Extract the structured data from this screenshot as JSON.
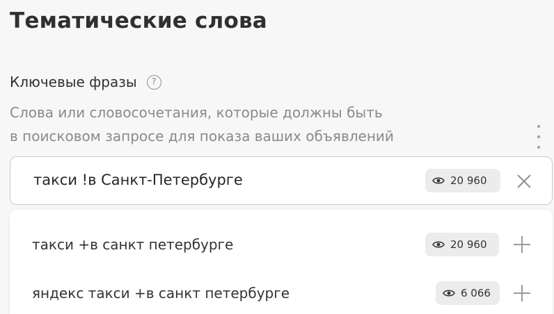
{
  "title": "Тематические слова",
  "keyphrases": {
    "label": "Ключевые фразы",
    "help_glyph": "?",
    "description_line1": "Слова или словосочетания, которые должны быть",
    "description_line2": "в поисковом запросе для показа ваших объявлений"
  },
  "input": {
    "value": "такси !в Санкт-Петербурге",
    "impressions": "20 960"
  },
  "suggestions": [
    {
      "phrase": "такси +в санкт петербурге",
      "impressions": "20 960"
    },
    {
      "phrase": "яндекс такси +в санкт петербурге",
      "impressions": "6 066"
    }
  ],
  "icons": {
    "impressions": "eye-icon",
    "clear": "close-icon",
    "add": "plus-icon",
    "more": "kebab-icon",
    "help": "question-icon"
  }
}
